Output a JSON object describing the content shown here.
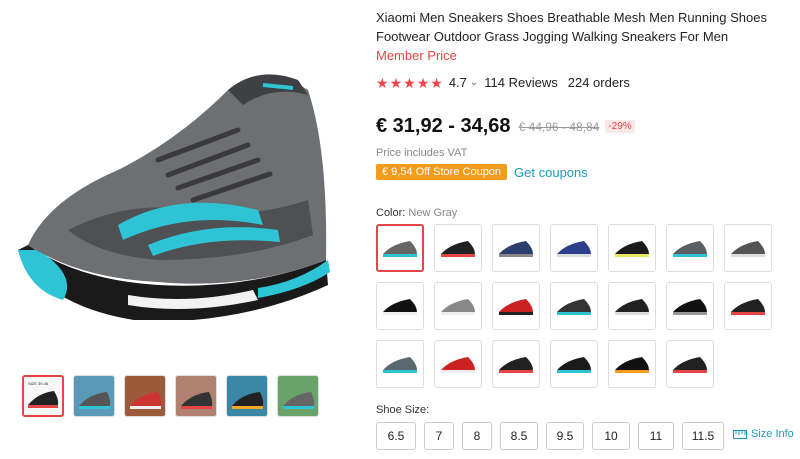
{
  "product": {
    "title": "Xiaomi Men Sneakers Shoes Breathable Mesh Men Running Shoes Footwear Outdoor Grass Jogging Walking Sneakers For Men",
    "member_price": "Member Price",
    "rating_value": "4.7",
    "rating_chevron": "⌄",
    "reviews": "114 Reviews",
    "orders": "224 orders",
    "price": "€ 31,92 - 34,68",
    "old_price": "€ 44,96 - 48,84",
    "discount": "-29%",
    "vat_note": "Price includes VAT",
    "coupon": "€ 9,54 Off Store Coupon",
    "get_coupons": "Get coupons"
  },
  "colors": {
    "label": "Color:",
    "selected": "New Gray",
    "swatch_count": 20
  },
  "sizes": {
    "label": "Shoe Size:",
    "options": [
      "6.5",
      "7",
      "8",
      "8.5",
      "9.5",
      "10",
      "11",
      "11.5"
    ],
    "size_info": "Size Info"
  },
  "gallery": {
    "thumbnail_count": 6,
    "first_thumb_text": "SIZE 39-46"
  },
  "theme": {
    "accent": "#e64545",
    "link": "#1a9bb9",
    "coupon": "#f59b1c",
    "star": "#f5434a"
  }
}
